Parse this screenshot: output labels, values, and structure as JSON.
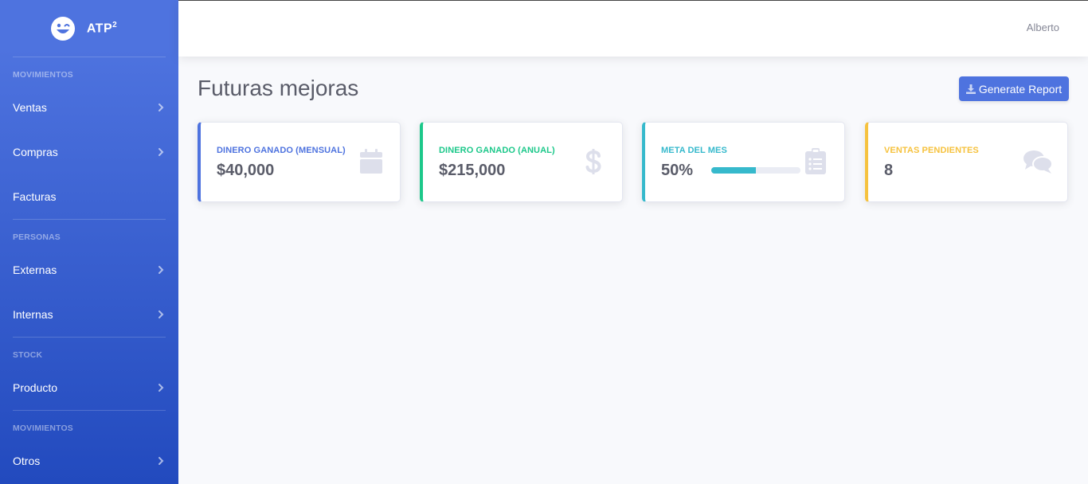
{
  "app": {
    "brand_name": "ATP",
    "brand_sup": "2"
  },
  "sidebar": {
    "sections": [
      {
        "heading": "MOVIMIENTOS",
        "items": [
          {
            "label": "Ventas",
            "chevron": true
          },
          {
            "label": "Compras",
            "chevron": true
          },
          {
            "label": "Facturas",
            "chevron": false
          }
        ]
      },
      {
        "heading": "PERSONAS",
        "items": [
          {
            "label": "Externas",
            "chevron": true
          },
          {
            "label": "Internas",
            "chevron": true
          }
        ]
      },
      {
        "heading": "STOCK",
        "items": [
          {
            "label": "Producto",
            "chevron": true
          }
        ]
      },
      {
        "heading": "MOVIMIENTOS",
        "items": [
          {
            "label": "Otros",
            "chevron": true
          }
        ]
      }
    ]
  },
  "topbar": {
    "user_name": "Alberto"
  },
  "main": {
    "title": "Futuras mejoras",
    "report_button": "Generate Report"
  },
  "cards": [
    {
      "label": "DINERO GANADO (MENSUAL)",
      "value": "$40,000",
      "color": "#4e73df",
      "icon": "calendar-icon"
    },
    {
      "label": "DINERO GANADO (ANUAL)",
      "value": "$215,000",
      "color": "#1cc88a",
      "icon": "dollar-icon"
    },
    {
      "label": "META DEL MES",
      "value": "50%",
      "color": "#36b9cc",
      "icon": "clipboard-list-icon",
      "progress_percent": 50
    },
    {
      "label": "VENTAS PENDIENTES",
      "value": "8",
      "color": "#f6c23e",
      "icon": "comments-icon"
    }
  ]
}
